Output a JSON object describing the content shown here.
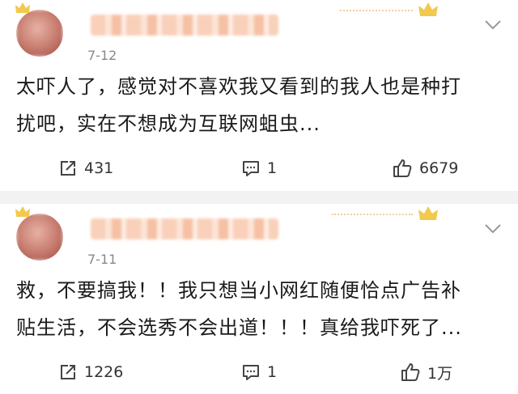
{
  "posts": [
    {
      "date": "7-12",
      "content_lines": [
        "太吓人了，感觉对不喜欢我又看到的我人也是种打",
        "扰吧，实在不想成为互联网蛆虫..."
      ],
      "reposts": "431",
      "comments": "1",
      "likes": "6679"
    },
    {
      "date": "7-11",
      "content_lines": [
        "救，不要搞我！！我只想当小网红随便恰点广告补",
        "贴生活，不会选秀不会出道！！！真给我吓死了..."
      ],
      "reposts": "1226",
      "comments": "1",
      "likes": "1万"
    }
  ],
  "icons": {
    "repost": "share-square-icon",
    "comment": "comment-bubble-icon",
    "like": "thumbs-up-icon",
    "more": "chevron-down-icon",
    "badge": "crown-icon"
  },
  "colors": {
    "text": "#1a1a1a",
    "meta": "#888888",
    "separator": "#f2f2f2",
    "crown": "#f2c94c"
  }
}
